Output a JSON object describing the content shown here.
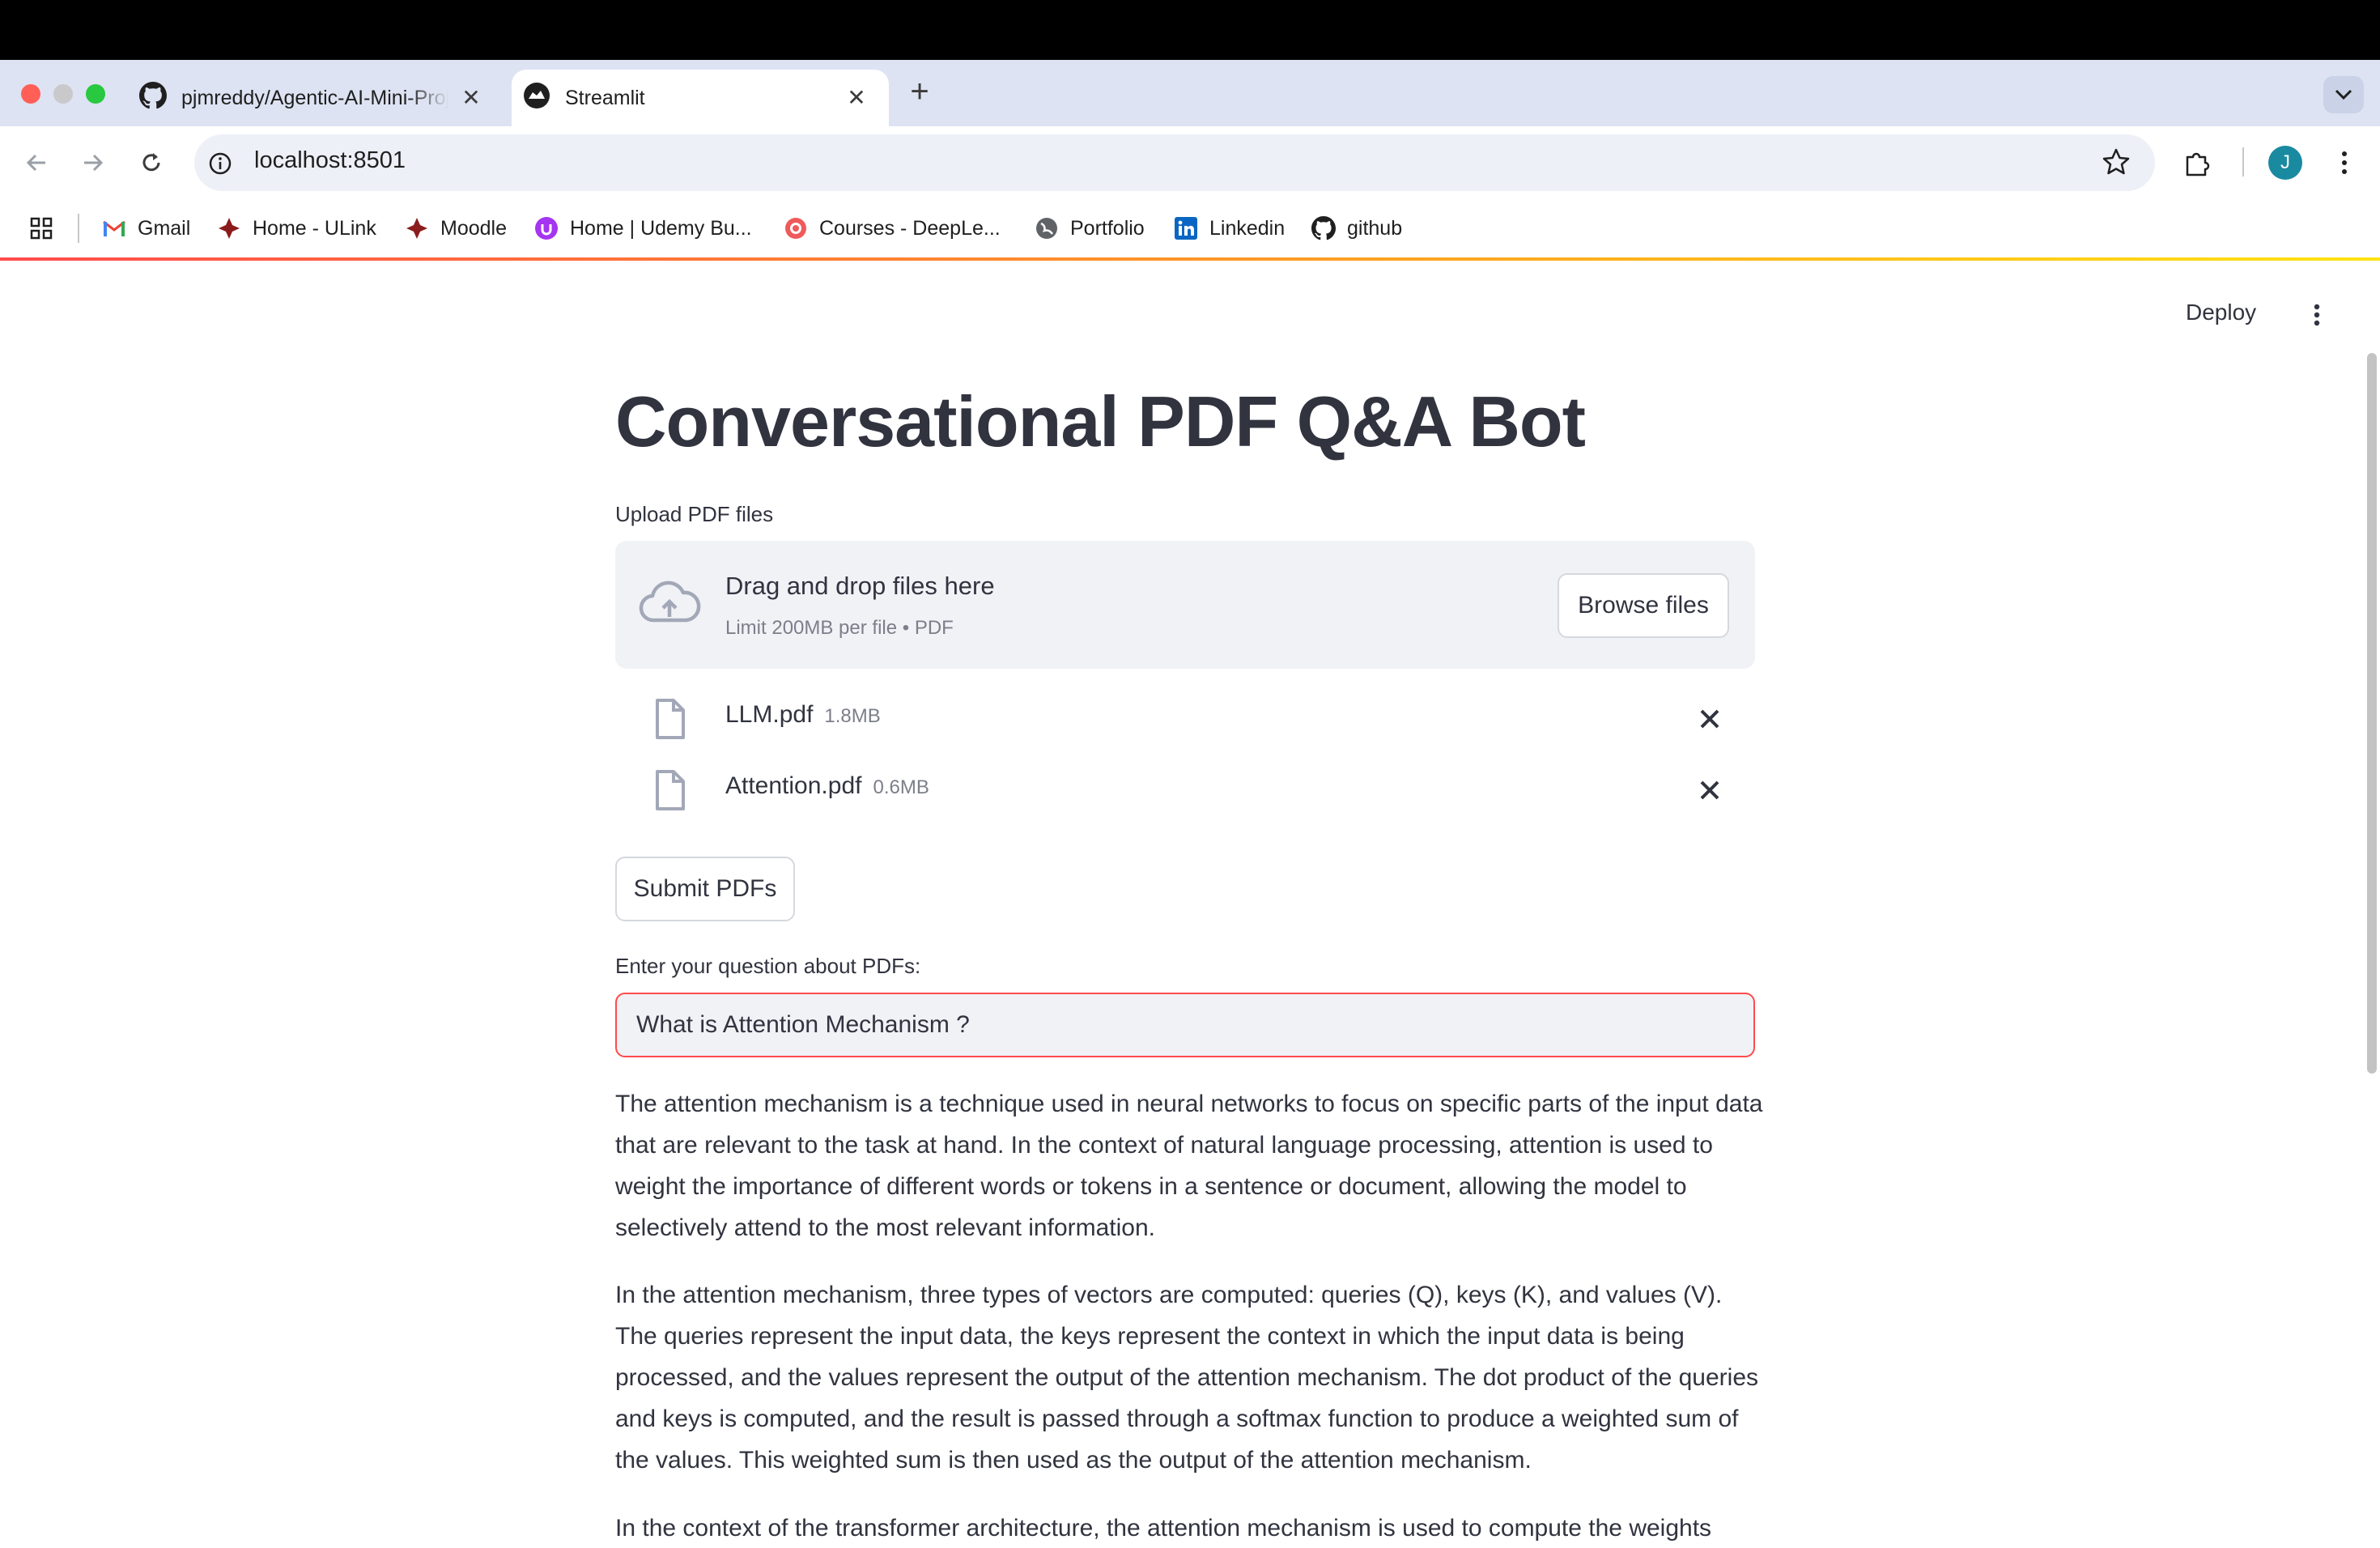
{
  "browser": {
    "tabs": [
      {
        "title": "pjmreddy/Agentic-AI-Mini-Projects",
        "active": false
      },
      {
        "title": "Streamlit",
        "active": true
      }
    ],
    "url": "localhost:8501",
    "profile_initial": "J",
    "bookmarks": [
      {
        "label": "Gmail",
        "icon": "gmail-icon"
      },
      {
        "label": "Home - ULink",
        "icon": "ulink-icon"
      },
      {
        "label": "Moodle",
        "icon": "moodle-icon"
      },
      {
        "label": "Home | Udemy Bu...",
        "icon": "udemy-icon"
      },
      {
        "label": "Courses - DeepLe...",
        "icon": "deeplearning-icon"
      },
      {
        "label": "Portfolio",
        "icon": "globe-icon"
      },
      {
        "label": "Linkedin",
        "icon": "linkedin-icon"
      },
      {
        "label": "github",
        "icon": "github-icon"
      }
    ]
  },
  "app": {
    "deploy_label": "Deploy",
    "title": "Conversational PDF Q&A Bot",
    "upload": {
      "label": "Upload PDF files",
      "drop_text": "Drag and drop files here",
      "limit_text": "Limit 200MB per file • PDF",
      "browse_label": "Browse files",
      "files": [
        {
          "name": "LLM.pdf",
          "size": "1.8MB"
        },
        {
          "name": "Attention.pdf",
          "size": "0.6MB"
        }
      ]
    },
    "submit_label": "Submit PDFs",
    "question": {
      "label": "Enter your question about PDFs:",
      "value": "What is Attention Mechanism ?"
    },
    "answer_paragraphs": [
      "The attention mechanism is a technique used in neural networks to focus on specific parts of the input data that are relevant to the task at hand. In the context of natural language processing, attention is used to weight the importance of different words or tokens in a sentence or document, allowing the model to selectively attend to the most relevant information.",
      "In the attention mechanism, three types of vectors are computed: queries (Q), keys (K), and values (V). The queries represent the input data, the keys represent the context in which the input data is being processed, and the values represent the output of the attention mechanism. The dot product of the queries and keys is computed, and the result is passed through a softmax function to produce a weighted sum of the values. This weighted sum is then used as the output of the attention mechanism.",
      "In the context of the transformer architecture, the attention mechanism is used to compute the weights"
    ]
  },
  "colors": {
    "accent": "#ff4b4b",
    "text": "#31333f",
    "muted": "#7c7f8a",
    "panel": "#f0f2f6"
  }
}
